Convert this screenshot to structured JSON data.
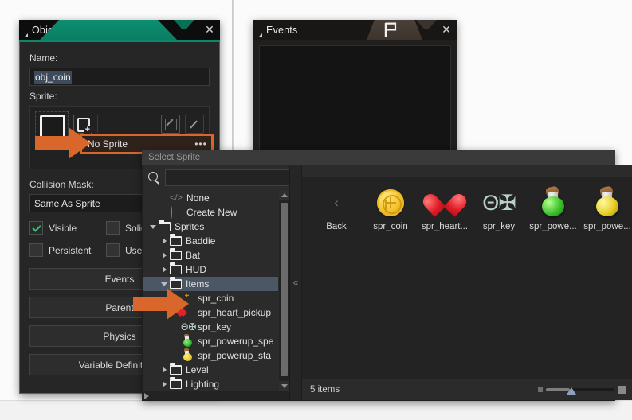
{
  "object_window": {
    "title": "Object: obj_coin",
    "close_label": "✕",
    "name_label": "Name:",
    "name_value": "obj_coin",
    "sprite_label": "Sprite:",
    "sprite_value": "No Sprite",
    "sprite_menu_label": "•••",
    "collision_label": "Collision Mask:",
    "collision_value": "Same As Sprite",
    "checkboxes": [
      {
        "label": "Visible",
        "checked": true
      },
      {
        "label": "Solid",
        "checked": false
      },
      {
        "label": "Persistent",
        "checked": false
      },
      {
        "label": "Uses Ph",
        "checked": false
      }
    ],
    "buttons": [
      {
        "label": "Events"
      },
      {
        "label": "Parent"
      },
      {
        "label": "Physics"
      },
      {
        "label": "Variable Definitions"
      }
    ]
  },
  "events_window": {
    "title": "Events",
    "close_label": "✕",
    "flag_icon": "flag-icon"
  },
  "select_sprite": {
    "title": "Select Sprite",
    "search_placeholder": "",
    "search_value": "",
    "collapse_label": "«",
    "status_count": "5 items",
    "tree": [
      {
        "label": "None",
        "depth": 1,
        "icon": "none-icon",
        "twisty": "",
        "selected": false
      },
      {
        "label": "Create New",
        "depth": 1,
        "icon": "circle-icon",
        "twisty": "",
        "selected": false
      },
      {
        "label": "Sprites",
        "depth": 0,
        "icon": "folder",
        "twisty": "down",
        "selected": false
      },
      {
        "label": "Baddie",
        "depth": 1,
        "icon": "folder",
        "twisty": "right",
        "selected": false
      },
      {
        "label": "Bat",
        "depth": 1,
        "icon": "folder",
        "twisty": "right",
        "selected": false
      },
      {
        "label": "HUD",
        "depth": 1,
        "icon": "folder",
        "twisty": "right",
        "selected": false
      },
      {
        "label": "Items",
        "depth": 1,
        "icon": "folder",
        "twisty": "down",
        "selected": true
      },
      {
        "label": "spr_coin",
        "depth": 2,
        "icon": "coin-icon",
        "twisty": "",
        "selected": false
      },
      {
        "label": "spr_heart_pickup",
        "depth": 2,
        "icon": "heart-icon",
        "twisty": "",
        "selected": false
      },
      {
        "label": "spr_key",
        "depth": 2,
        "icon": "key-icon",
        "twisty": "",
        "selected": false
      },
      {
        "label": "spr_powerup_spe",
        "depth": 2,
        "icon": "potion-green-icon",
        "twisty": "",
        "selected": false
      },
      {
        "label": "spr_powerup_sta",
        "depth": 2,
        "icon": "potion-yellow-icon",
        "twisty": "",
        "selected": false
      },
      {
        "label": "Level",
        "depth": 1,
        "icon": "folder",
        "twisty": "right",
        "selected": false
      },
      {
        "label": "Lighting",
        "depth": 1,
        "icon": "folder",
        "twisty": "right",
        "selected": false
      }
    ],
    "grid": [
      {
        "label": "Back",
        "icon": "back-arrow-icon"
      },
      {
        "label": "spr_coin",
        "icon": "coin-icon"
      },
      {
        "label": "spr_heart...",
        "icon": "heart-icon"
      },
      {
        "label": "spr_key",
        "icon": "key-icon"
      },
      {
        "label": "spr_powe...",
        "icon": "potion-green-icon"
      },
      {
        "label": "spr_powe...",
        "icon": "potion-yellow-icon"
      }
    ]
  },
  "colors": {
    "accent_green": "#0b8a6b",
    "arrow_orange": "#d9662a",
    "highlight_row": "#4c5766",
    "window_bg": "#262626"
  }
}
